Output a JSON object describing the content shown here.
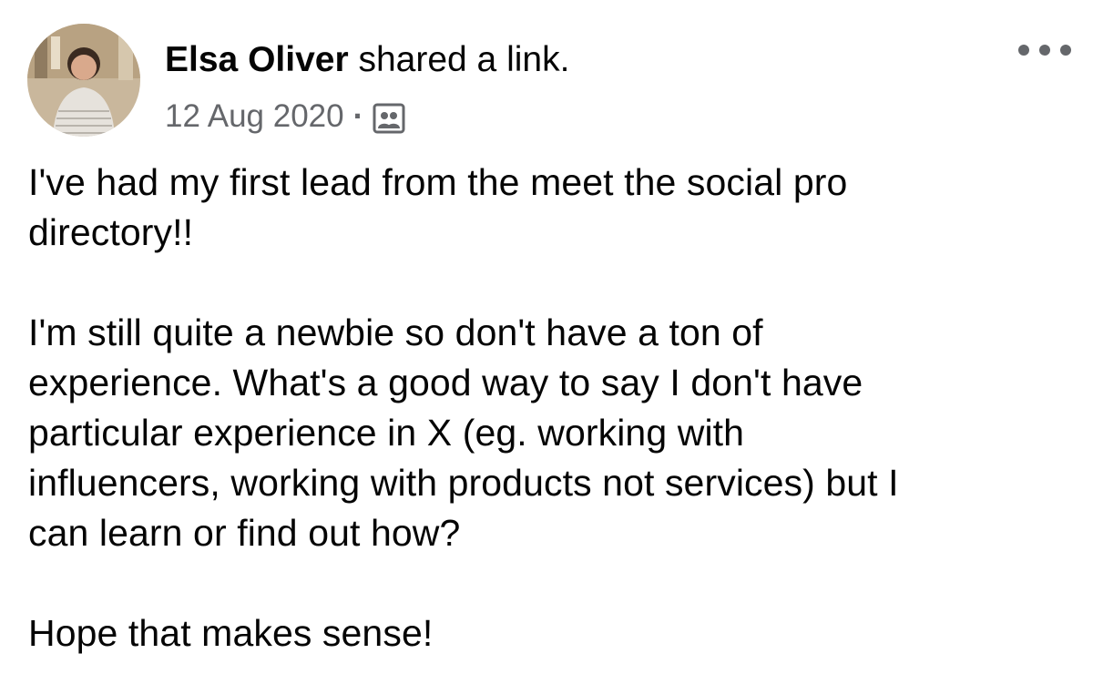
{
  "post": {
    "author_name": "Elsa Oliver",
    "action": " shared a link.",
    "date": "12 Aug 2020",
    "separator": "·",
    "audience_icon": "group-icon",
    "more_icon": "more-options-icon",
    "paragraphs": [
      "I've had my first lead from the meet the social pro\ndirectory!!",
      "I'm still quite a newbie so don't have a ton of\nexperience. What's a good way to say I don't have\nparticular experience in X (eg. working with\ninfluencers, working with products not services) but I\ncan learn or find out how?",
      "Hope that makes sense!"
    ]
  },
  "colors": {
    "text_primary": "#050505",
    "text_secondary": "#65676b",
    "background": "#ffffff"
  }
}
